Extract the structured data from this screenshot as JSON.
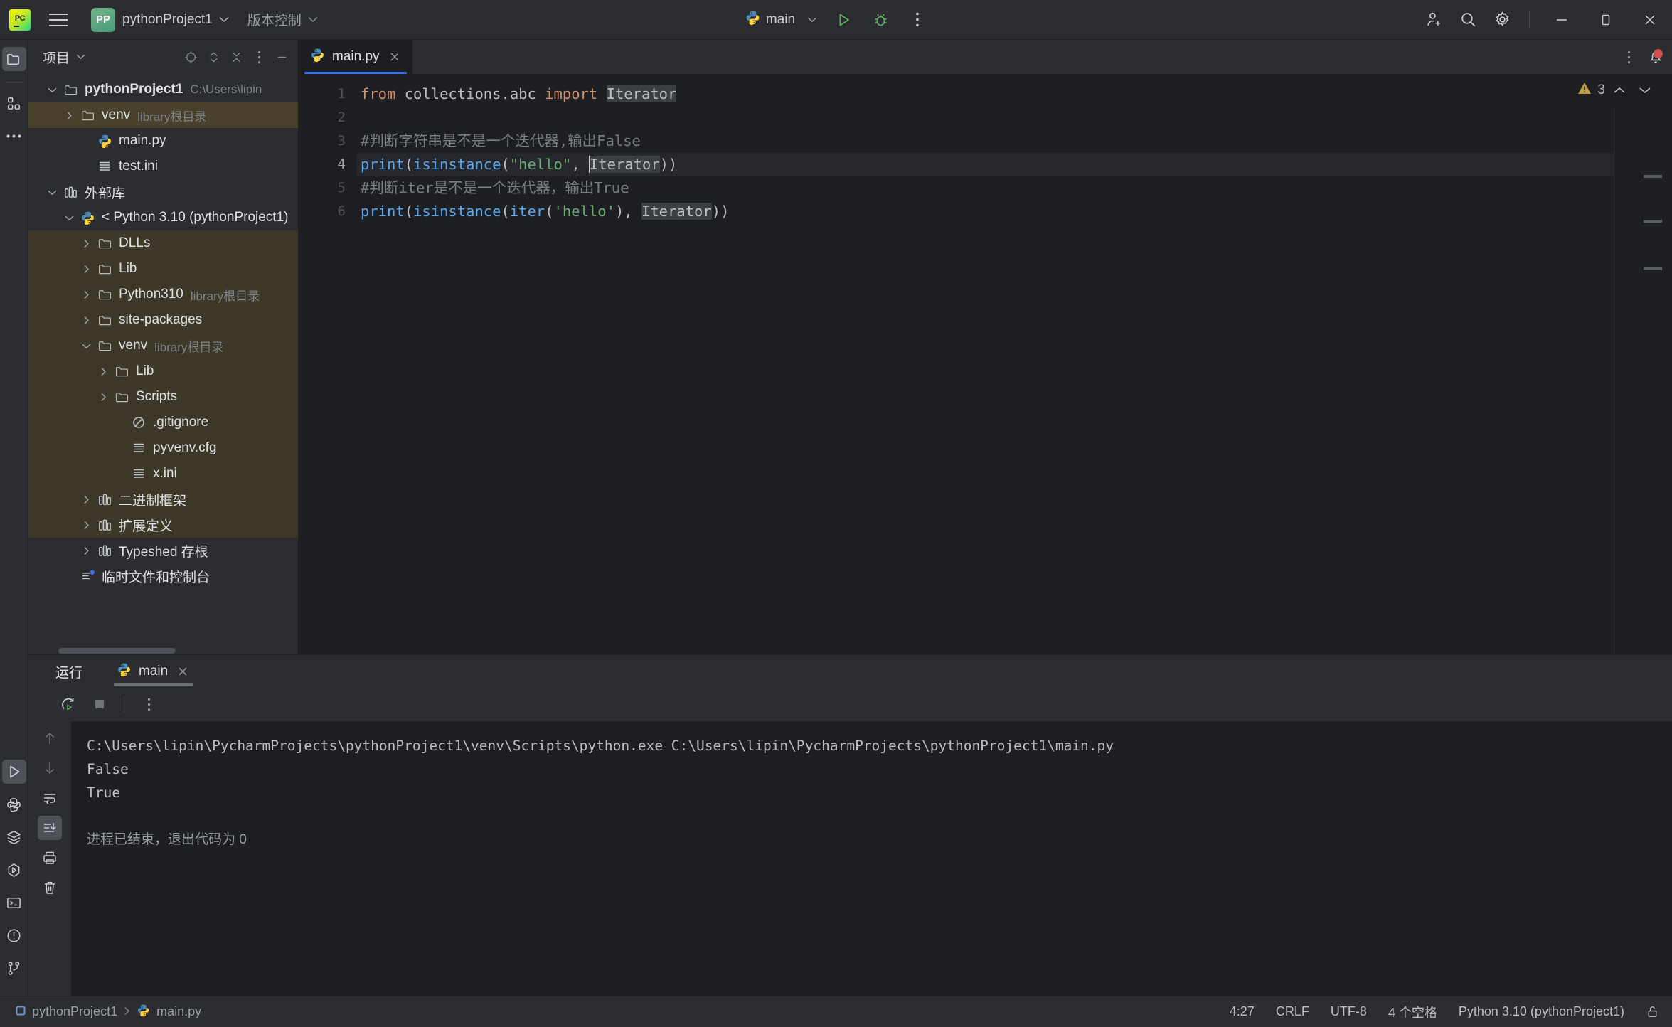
{
  "titlebar": {
    "project_badge": "PP",
    "project_name": "pythonProject1",
    "vcs_label": "版本控制",
    "run_config": "main",
    "icons": {
      "app_logo": "pycharm-logo-icon",
      "menu": "hamburger-menu-icon",
      "run": "run-icon",
      "debug": "debug-icon",
      "more": "more-vertical-icon",
      "invite": "add-user-icon",
      "search": "search-icon",
      "settings": "gear-icon",
      "minimize": "minimize-icon",
      "maximize": "maximize-icon",
      "close": "close-icon"
    }
  },
  "rail": {
    "top": [
      "project-folder-icon",
      "structure-icon",
      "more-tools-icon"
    ],
    "bottom": [
      "run-icon",
      "python-console-icon",
      "services-icon",
      "python-packages-icon",
      "terminal-icon",
      "problems-icon",
      "version-control-icon"
    ]
  },
  "project_panel": {
    "title": "项目",
    "tools": [
      "locate-icon",
      "expand-collapse-icon",
      "collapse-all-icon",
      "options-icon",
      "hide-icon"
    ],
    "tree": [
      {
        "label": "pythonProject1",
        "sub": "C:\\Users\\lipin",
        "indent": 0,
        "twisty": "down",
        "icon": "folder-icon",
        "bold": true,
        "style": ""
      },
      {
        "label": "venv",
        "sub": "library根目录",
        "indent": 1,
        "twisty": "right",
        "icon": "folder-icon",
        "bold": false,
        "style": "sel-amber"
      },
      {
        "label": "main.py",
        "sub": "",
        "indent": 2,
        "twisty": "",
        "icon": "python-file-icon",
        "bold": false,
        "style": ""
      },
      {
        "label": "test.ini",
        "sub": "",
        "indent": 2,
        "twisty": "",
        "icon": "ini-file-icon",
        "bold": false,
        "style": ""
      },
      {
        "label": "外部库",
        "sub": "",
        "indent": 0,
        "twisty": "down",
        "icon": "library-icon",
        "bold": false,
        "style": ""
      },
      {
        "label": "< Python 3.10 (pythonProject1)",
        "sub": "",
        "indent": 1,
        "twisty": "down",
        "icon": "python-file-icon",
        "bold": false,
        "style": ""
      },
      {
        "label": "DLLs",
        "sub": "",
        "indent": 2,
        "twisty": "right",
        "icon": "folder-icon",
        "bold": false,
        "style": "amberband"
      },
      {
        "label": "Lib",
        "sub": "",
        "indent": 2,
        "twisty": "right",
        "icon": "folder-icon",
        "bold": false,
        "style": "amberband"
      },
      {
        "label": "Python310",
        "sub": "library根目录",
        "indent": 2,
        "twisty": "right",
        "icon": "folder-icon",
        "bold": false,
        "style": "amberband"
      },
      {
        "label": "site-packages",
        "sub": "",
        "indent": 2,
        "twisty": "right",
        "icon": "folder-icon",
        "bold": false,
        "style": "amberband"
      },
      {
        "label": "venv",
        "sub": "library根目录",
        "indent": 2,
        "twisty": "down",
        "icon": "folder-icon",
        "bold": false,
        "style": "amberband"
      },
      {
        "label": "Lib",
        "sub": "",
        "indent": 3,
        "twisty": "right",
        "icon": "folder-icon",
        "bold": false,
        "style": "amberband"
      },
      {
        "label": "Scripts",
        "sub": "",
        "indent": 3,
        "twisty": "right",
        "icon": "folder-icon",
        "bold": false,
        "style": "amberband"
      },
      {
        "label": ".gitignore",
        "sub": "",
        "indent": 4,
        "twisty": "",
        "icon": "gitignore-icon",
        "bold": false,
        "style": "amberband"
      },
      {
        "label": "pyvenv.cfg",
        "sub": "",
        "indent": 4,
        "twisty": "",
        "icon": "cfg-file-icon",
        "bold": false,
        "style": "amberband"
      },
      {
        "label": "x.ini",
        "sub": "",
        "indent": 4,
        "twisty": "",
        "icon": "ini-file-icon",
        "bold": false,
        "style": "amberband"
      },
      {
        "label": "二进制框架",
        "sub": "",
        "indent": 2,
        "twisty": "right",
        "icon": "library-icon",
        "bold": false,
        "style": "amberband"
      },
      {
        "label": "扩展定义",
        "sub": "",
        "indent": 2,
        "twisty": "right",
        "icon": "library-icon",
        "bold": false,
        "style": "amberband"
      },
      {
        "label": "Typeshed 存根",
        "sub": "",
        "indent": 2,
        "twisty": "right",
        "icon": "library-icon",
        "bold": false,
        "style": ""
      },
      {
        "label": "临时文件和控制台",
        "sub": "",
        "indent": 1,
        "twisty": "",
        "icon": "scratches-icon",
        "bold": false,
        "style": ""
      }
    ]
  },
  "editor": {
    "tab": {
      "label": "main.py",
      "icon": "python-file-icon",
      "close": "close-icon"
    },
    "tabbar_icons": [
      "more-vertical-icon",
      "notifications-bell-icon"
    ],
    "inspections": {
      "icon": "warning-triangle-icon",
      "count": "3",
      "prev": "chevron-up-icon",
      "next": "chevron-down-icon"
    },
    "lines": [
      {
        "n": "1",
        "current": false
      },
      {
        "n": "2",
        "current": false
      },
      {
        "n": "3",
        "current": false
      },
      {
        "n": "4",
        "current": true
      },
      {
        "n": "5",
        "current": false
      },
      {
        "n": "6",
        "current": false
      }
    ],
    "code": {
      "l1_kw_from": "from",
      "l1_module": " collections.abc ",
      "l1_kw_import": "import",
      "l1_name": "Iterator",
      "l3_comment": "#判断字符串是不是一个迭代器,输出False",
      "l4_fn": "print",
      "l4_p1": "(",
      "l4_fn2": "isinstance",
      "l4_p2": "(",
      "l4_str": "\"hello\"",
      "l4_comma": ", ",
      "l4_name": "Iterator",
      "l4_close": "))",
      "l5_comment": "#判断iter是不是一个迭代器，输出True",
      "l6_fn": "print",
      "l6_p1": "(",
      "l6_fn2": "isinstance",
      "l6_p2": "(",
      "l6_fn3": "iter",
      "l6_p3": "(",
      "l6_str": "'hello'",
      "l6_p4": ")",
      "l6_comma": ", ",
      "l6_name": "Iterator",
      "l6_close": "))"
    }
  },
  "run_panel": {
    "title": "运行",
    "tab": {
      "label": "main",
      "icon": "python-file-icon",
      "close": "close-icon"
    },
    "toolbar": [
      "rerun-icon",
      "stop-icon",
      "more-vertical-icon"
    ],
    "gutter": [
      "arrow-up-icon",
      "arrow-down-icon",
      "soft-wrap-icon",
      "scroll-to-end-icon",
      "print-icon",
      "trash-icon"
    ],
    "console": {
      "command": "C:\\Users\\lipin\\PycharmProjects\\pythonProject1\\venv\\Scripts\\python.exe C:\\Users\\lipin\\PycharmProjects\\pythonProject1\\main.py",
      "out1": "False",
      "out2": "True",
      "exit": "进程已结束，退出代码为 0"
    }
  },
  "statusbar": {
    "breadcrumb_project": "pythonProject1",
    "breadcrumb_file": "main.py",
    "caret": "4:27",
    "line_sep": "CRLF",
    "encoding": "UTF-8",
    "indent": "4 个空格",
    "interpreter": "Python 3.10 (pythonProject1)",
    "lock_icon": "unlocked-icon"
  },
  "colors": {
    "accent": "#3574f0",
    "keyword": "#cf8e6d",
    "function": "#56a8f5",
    "string": "#6aab73",
    "comment": "#7a7e85",
    "warning": "#c6a700"
  }
}
